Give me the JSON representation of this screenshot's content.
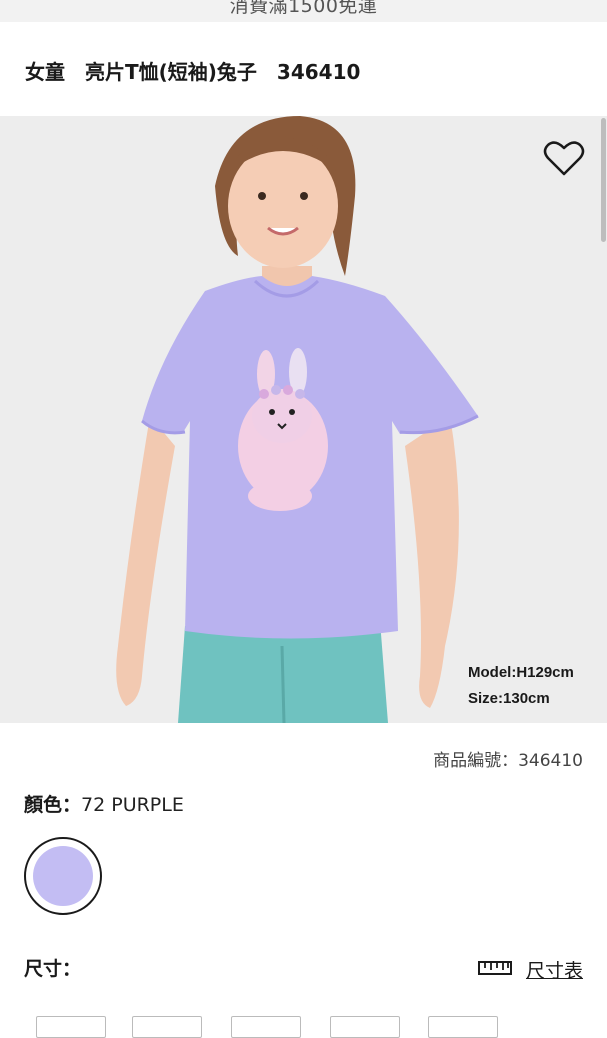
{
  "banner": {
    "text": "消費滿1500免運"
  },
  "product": {
    "title": "女童　亮片T恤(短袖)兔子　346410",
    "model_line1": "Model:H129cm",
    "model_line2": "Size:130cm",
    "product_code": "商品編號：346410"
  },
  "color": {
    "label": "顏色：",
    "value": "72 PURPLE",
    "swatch_hex": "#c3bdf3"
  },
  "size": {
    "label": "尺寸：",
    "chart_link": "尺寸表"
  },
  "icons": {
    "favorite": "heart-icon",
    "size_chart": "ruler-icon"
  },
  "colors": {
    "tshirt": "#b9b2ef",
    "pants": "#6fc2c0",
    "hero_bg": "#ededed"
  }
}
